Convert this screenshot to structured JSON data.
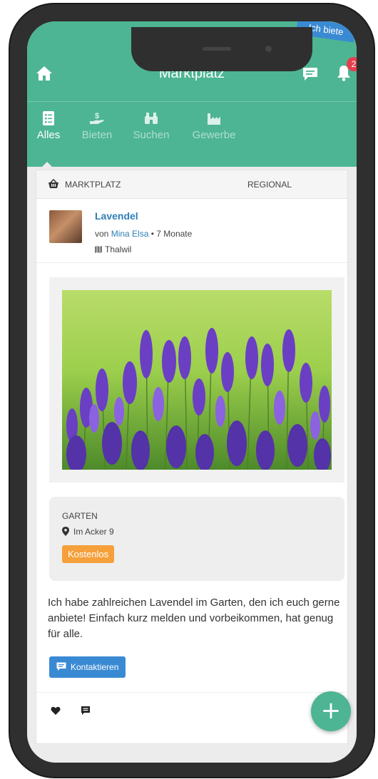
{
  "header": {
    "title": "Marktplatz",
    "notifications_count": "2"
  },
  "tabs": [
    {
      "label": "Alles",
      "icon": "list-icon",
      "active": true
    },
    {
      "label": "Bieten",
      "icon": "hand-money-icon",
      "active": false
    },
    {
      "label": "Suchen",
      "icon": "binoculars-icon",
      "active": false
    },
    {
      "label": "Gewerbe",
      "icon": "factory-icon",
      "active": false
    }
  ],
  "post": {
    "category": "MARKTPLATZ",
    "scope": "REGIONAL",
    "ribbon": "Ich biete",
    "title": "Lavendel",
    "by_prefix": "von",
    "author": "Mina Elsa",
    "age": "• 7 Monate",
    "location": "Thalwil",
    "subcategory": "GARTEN",
    "address": "Im Acker 9",
    "price": "Kostenlos",
    "description": "Ich habe zahlreichen Lavendel im Garten, den ich euch gerne anbiete! Einfach kurz melden und vorbeikommen, hat genug für alle.",
    "contact_label": "Kontaktieren"
  },
  "fab_label": "+",
  "colors": {
    "brand": "#4db593",
    "link": "#2f7fb8",
    "button": "#3a8ad3",
    "price": "#f5a03a",
    "badge": "#e53e4d"
  }
}
